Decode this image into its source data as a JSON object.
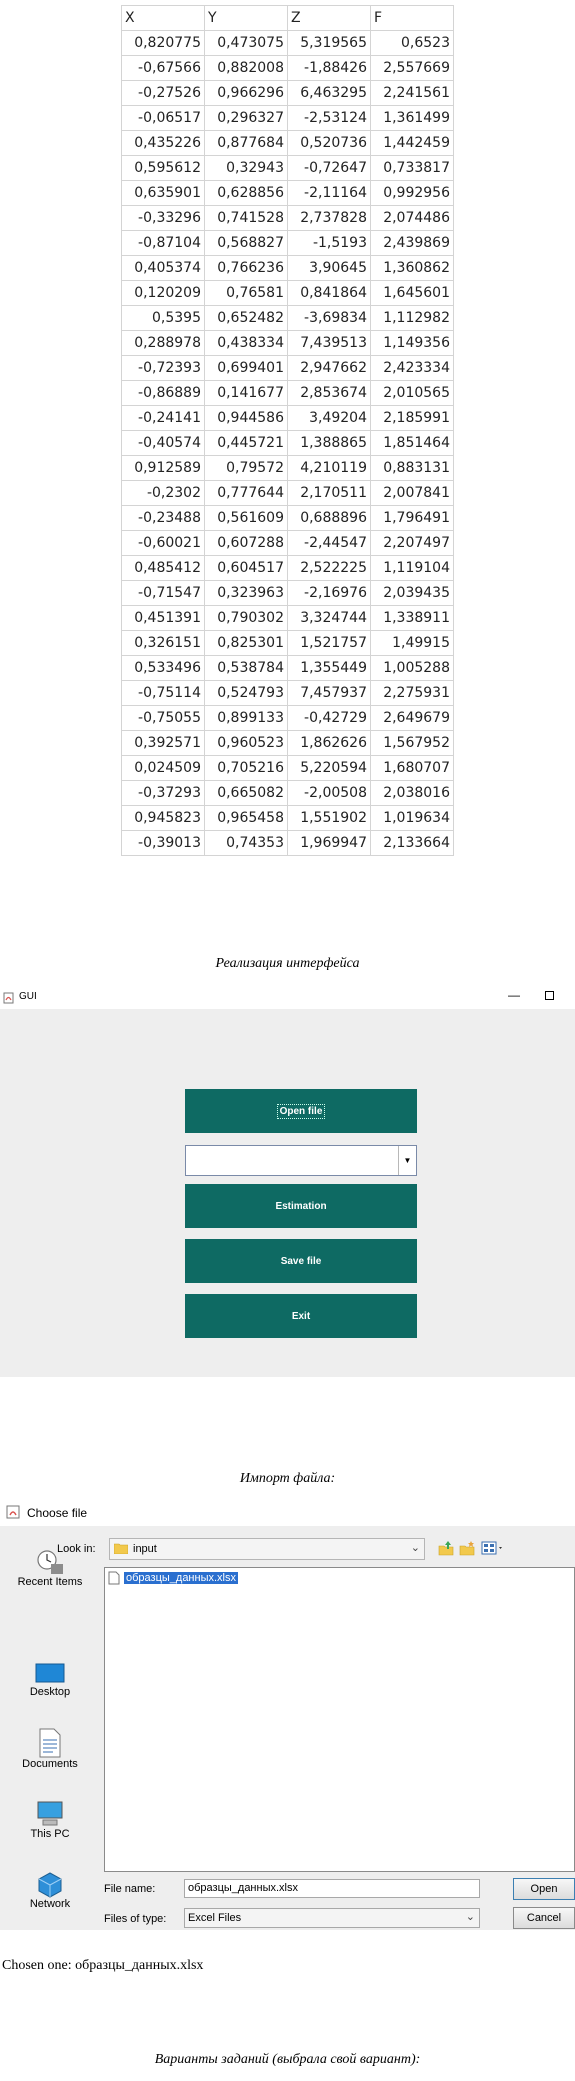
{
  "spreadsheet": {
    "headers": [
      "X",
      "Y",
      "Z",
      "F"
    ],
    "rows": [
      [
        "0,820775",
        "0,473075",
        "5,319565",
        "0,6523"
      ],
      [
        "-0,67566",
        "0,882008",
        "-1,88426",
        "2,557669"
      ],
      [
        "-0,27526",
        "0,966296",
        "6,463295",
        "2,241561"
      ],
      [
        "-0,06517",
        "0,296327",
        "-2,53124",
        "1,361499"
      ],
      [
        "0,435226",
        "0,877684",
        "0,520736",
        "1,442459"
      ],
      [
        "0,595612",
        "0,32943",
        "-0,72647",
        "0,733817"
      ],
      [
        "0,635901",
        "0,628856",
        "-2,11164",
        "0,992956"
      ],
      [
        "-0,33296",
        "0,741528",
        "2,737828",
        "2,074486"
      ],
      [
        "-0,87104",
        "0,568827",
        "-1,5193",
        "2,439869"
      ],
      [
        "0,405374",
        "0,766236",
        "3,90645",
        "1,360862"
      ],
      [
        "0,120209",
        "0,76581",
        "0,841864",
        "1,645601"
      ],
      [
        "0,5395",
        "0,652482",
        "-3,69834",
        "1,112982"
      ],
      [
        "0,288978",
        "0,438334",
        "7,439513",
        "1,149356"
      ],
      [
        "-0,72393",
        "0,699401",
        "2,947662",
        "2,423334"
      ],
      [
        "-0,86889",
        "0,141677",
        "2,853674",
        "2,010565"
      ],
      [
        "-0,24141",
        "0,944586",
        "3,49204",
        "2,185991"
      ],
      [
        "-0,40574",
        "0,445721",
        "1,388865",
        "1,851464"
      ],
      [
        "0,912589",
        "0,79572",
        "4,210119",
        "0,883131"
      ],
      [
        "-0,2302",
        "0,777644",
        "2,170511",
        "2,007841"
      ],
      [
        "-0,23488",
        "0,561609",
        "0,688896",
        "1,796491"
      ],
      [
        "-0,60021",
        "0,607288",
        "-2,44547",
        "2,207497"
      ],
      [
        "0,485412",
        "0,604517",
        "2,522225",
        "1,119104"
      ],
      [
        "-0,71547",
        "0,323963",
        "-2,16976",
        "2,039435"
      ],
      [
        "0,451391",
        "0,790302",
        "3,324744",
        "1,338911"
      ],
      [
        "0,326151",
        "0,825301",
        "1,521757",
        "1,49915"
      ],
      [
        "0,533496",
        "0,538784",
        "1,355449",
        "1,005288"
      ],
      [
        "-0,75114",
        "0,524793",
        "7,457937",
        "2,275931"
      ],
      [
        "-0,75055",
        "0,899133",
        "-0,42729",
        "2,649679"
      ],
      [
        "0,392571",
        "0,960523",
        "1,862626",
        "1,567952"
      ],
      [
        "0,024509",
        "0,705216",
        "5,220594",
        "1,680707"
      ],
      [
        "-0,37293",
        "0,665082",
        "-2,00508",
        "2,038016"
      ],
      [
        "0,945823",
        "0,965458",
        "1,551902",
        "1,019634"
      ],
      [
        "-0,39013",
        "0,74353",
        "1,969947",
        "2,133664"
      ]
    ]
  },
  "captions": {
    "interface": "Реализация интерфейса",
    "import": "Импорт файла:",
    "variants": "Варианты заданий (выбрала свой вариант):"
  },
  "gui_window": {
    "title": "GUI",
    "buttons": {
      "open_file": "Open file",
      "estimation": "Estimation",
      "save_file": "Save file",
      "exit": "Exit"
    },
    "combo_value": "",
    "accent_color": "#0e6a63"
  },
  "file_chooser": {
    "title": "Choose file",
    "look_in_label": "Look in:",
    "look_in_value": "input",
    "places": [
      "Recent Items",
      "Desktop",
      "Documents",
      "This PC",
      "Network"
    ],
    "files": [
      "образцы_данных.xlsx"
    ],
    "file_name_label": "File name:",
    "file_name_value": "образцы_данных.xlsx",
    "files_of_type_label": "Files of type:",
    "files_of_type_value": "Excel Files",
    "open_label": "Open",
    "cancel_label": "Cancel"
  },
  "chosen_text": "Chosen one: образцы_данных.xlsx"
}
